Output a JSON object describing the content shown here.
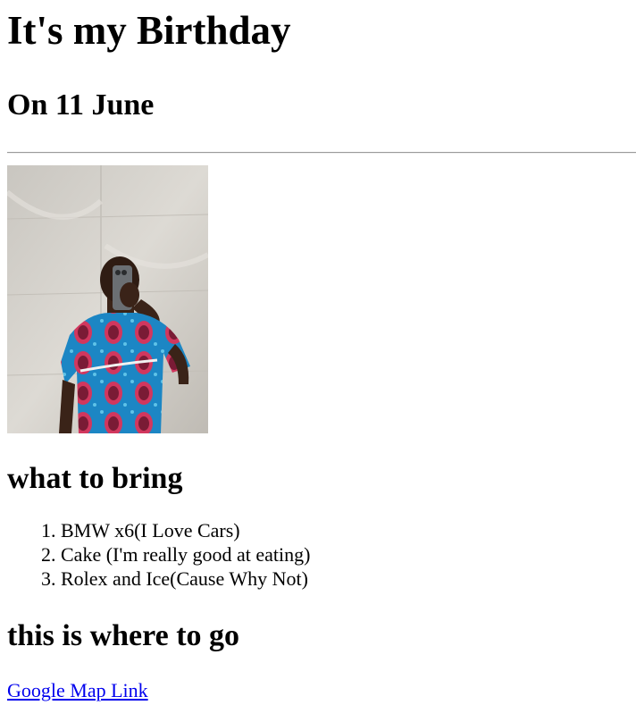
{
  "title": "It's my Birthday",
  "date_heading": "On 11 June",
  "sections": {
    "bring_heading": "what to bring",
    "items": [
      "BMW x6(I Love Cars)",
      "Cake (I'm really good at eating)",
      "Rolex and Ice(Cause Why Not)"
    ],
    "go_heading": "this is where to go",
    "map_link": "Google Map Link"
  },
  "colors": {
    "link": "#0000ee",
    "shirt_blue": "#1f7fc1",
    "shirt_pink": "#d8315b",
    "wall": "#d8d5cf"
  }
}
